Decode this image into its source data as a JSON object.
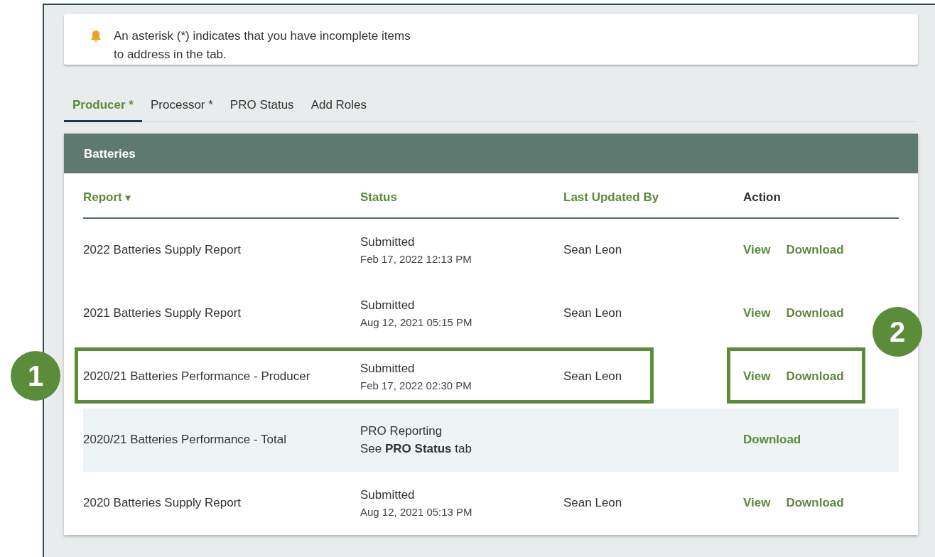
{
  "notice": {
    "text": "An asterisk (*) indicates that you have incomplete items to address in the tab."
  },
  "tabs": [
    {
      "label": "Producer *",
      "selected": true
    },
    {
      "label": "Processor *",
      "selected": false
    },
    {
      "label": "PRO Status",
      "selected": false
    },
    {
      "label": "Add Roles",
      "selected": false
    }
  ],
  "section": {
    "title": "Batteries"
  },
  "table": {
    "columns": [
      {
        "label": "Report",
        "sortable": true,
        "sort_arrow": "▼"
      },
      {
        "label": "Status",
        "sortable": true
      },
      {
        "label": "Last Updated By",
        "sortable": true
      },
      {
        "label": "Action",
        "sortable": false
      }
    ],
    "rows": [
      {
        "report": "2022 Batteries Supply Report",
        "status": {
          "text": "Submitted",
          "date": "Feb 17, 2022 12:13 PM"
        },
        "updated_by": "Sean Leon",
        "actions": [
          "View",
          "Download"
        ],
        "highlighted": false
      },
      {
        "report": "2021 Batteries Supply Report",
        "status": {
          "text": "Submitted",
          "date": "Aug 12, 2021 05:15 PM"
        },
        "updated_by": "Sean Leon",
        "actions": [
          "View",
          "Download"
        ],
        "highlighted": false
      },
      {
        "report": "2020/21 Batteries Performance - Producer",
        "status": {
          "text": "Submitted",
          "date": "Feb 17, 2022 02:30 PM"
        },
        "updated_by": "Sean Leon",
        "actions": [
          "View",
          "Download"
        ],
        "highlighted": false,
        "annotations": [
          {
            "kind": "details",
            "label": "1"
          },
          {
            "kind": "actions",
            "label": "2"
          }
        ]
      },
      {
        "report": "2020/21 Batteries Performance - Total",
        "status": {
          "text": "PRO Reporting",
          "note": "See **PRO Status** tab"
        },
        "actions": [
          "Download"
        ],
        "highlighted": true
      },
      {
        "report": "2020 Batteries Supply Report",
        "status": {
          "text": "Submitted",
          "date": "Aug 12, 2021 05:13 PM"
        },
        "updated_by": "Sean Leon",
        "actions": [
          "View",
          "Download"
        ],
        "highlighted": false
      }
    ]
  }
}
